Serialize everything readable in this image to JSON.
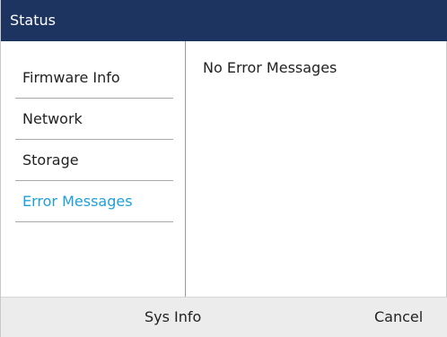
{
  "header": {
    "title": "Status"
  },
  "menu": {
    "items": [
      {
        "label": "Firmware Info",
        "active": false
      },
      {
        "label": "Network",
        "active": false
      },
      {
        "label": "Storage",
        "active": false
      },
      {
        "label": "Error Messages",
        "active": true
      }
    ]
  },
  "content": {
    "message": "No Error Messages"
  },
  "softkeys": {
    "sys_info": "Sys Info",
    "cancel": "Cancel"
  },
  "colors": {
    "title_bar": "#1d3461",
    "active_item": "#1f9fd9",
    "softkey_bar": "#ececec"
  }
}
